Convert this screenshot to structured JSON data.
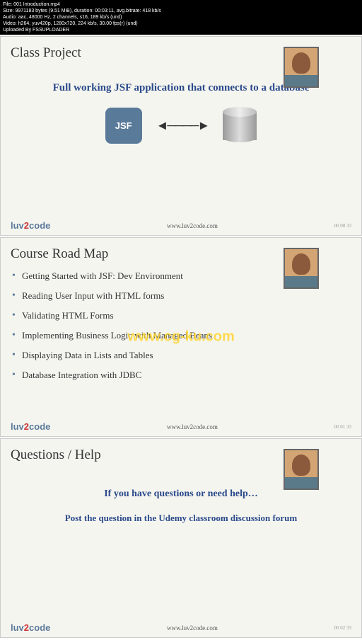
{
  "metadata": {
    "file": "File: 001 Introduction.mp4",
    "size": "Size: 9971183 bytes (9.51 MiB), duration: 00:03:11, avg.bitrate: 418 kb/s",
    "audio": "Audio: aac, 48000 Hz, 2 channels, s16, 189 kb/s (und)",
    "video": "Video: h264, yuv420p, 1280x720, 224 kb/s, 30.00 fps(r) (und)",
    "uploaded": "Uploaded By FSSUPLOADER"
  },
  "slide1": {
    "title": "Class Project",
    "headline": "Full working JSF application that connects to a database",
    "jsf_label": "JSF",
    "url": "www.luv2code.com",
    "slidenum": "00 00 33"
  },
  "slide2": {
    "title": "Course Road Map",
    "items": [
      "Getting Started with JSF:  Dev Environment",
      "Reading User Input with HTML forms",
      "Validating HTML Forms",
      "Implementing Business Logic with Managed Beans",
      "Displaying Data in Lists and Tables",
      "Database Integration with JDBC"
    ],
    "watermark": "www.cg-ku.com",
    "url": "www.luv2code.com",
    "slidenum": "00 01 33"
  },
  "slide3": {
    "title": "Questions / Help",
    "line1": "If you have questions or need help…",
    "line2": "Post the question in the Udemy classroom discussion forum",
    "url": "www.luv2code.com",
    "slidenum": "00 02 33"
  },
  "logo": {
    "part1": "luv",
    "part2": "2",
    "part3": "code"
  }
}
